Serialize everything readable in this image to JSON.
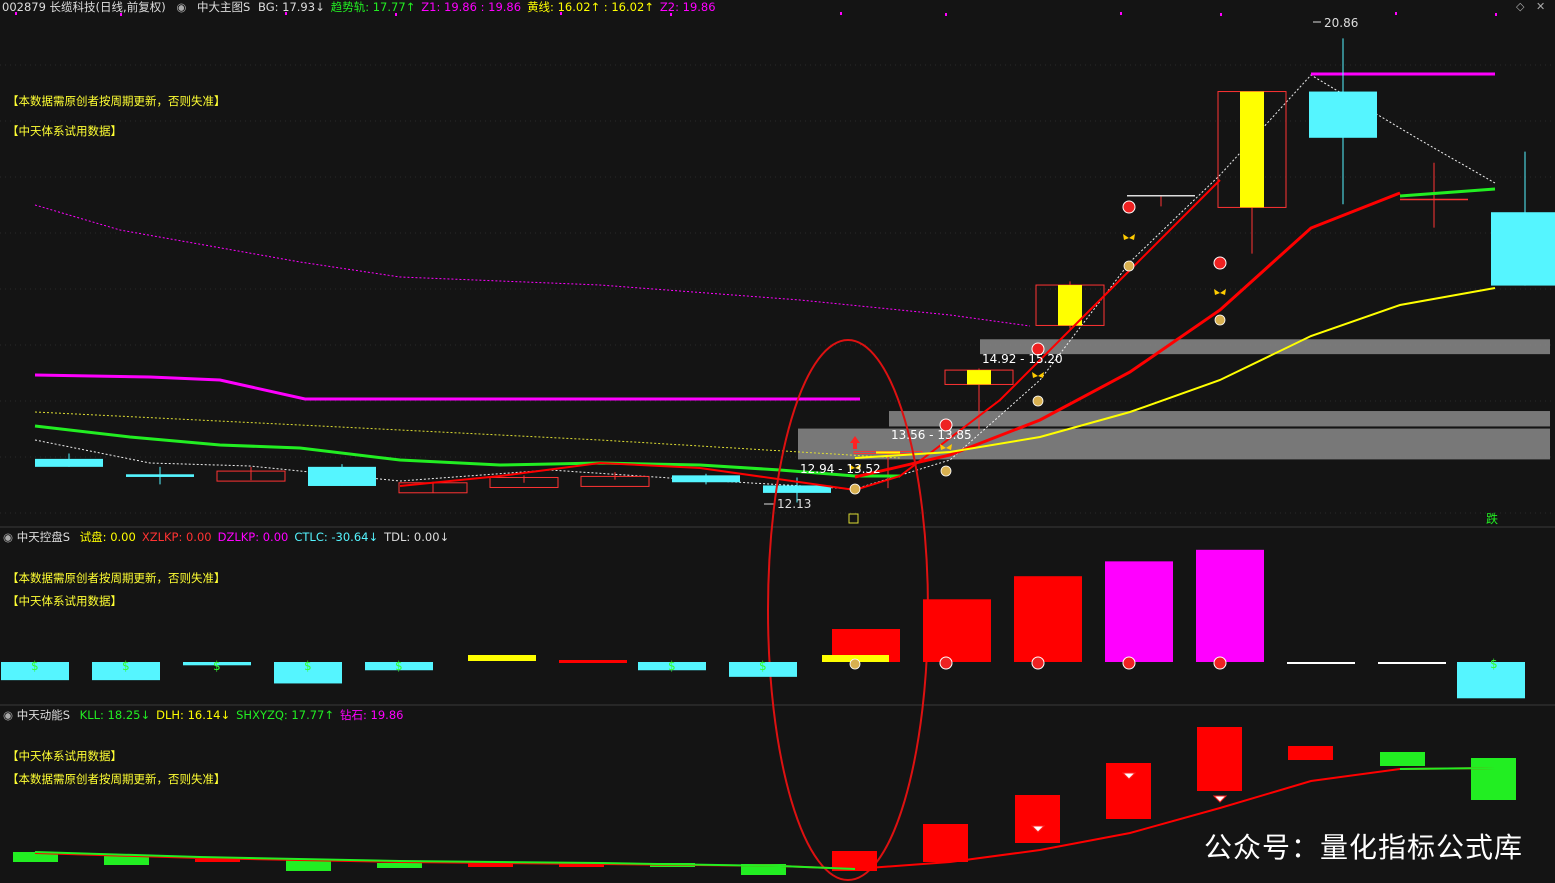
{
  "colors": {
    "background": "#141414",
    "cyan": "#55f5ff",
    "red": "#ff0000",
    "yellow": "#ffff00",
    "magenta": "#ff00ff",
    "green": "#22ee22",
    "gray": "#8a8a8a",
    "white": "#ffffff"
  },
  "main_panel": {
    "stock_label": "002879 长缆科技(日线,前复权)",
    "indicator_name": "中大主图S",
    "params": [
      {
        "text": "BG: 17.93↓",
        "color": "#dddddd"
      },
      {
        "text": "趋势轨: 17.77↑",
        "color": "#22ee22"
      },
      {
        "text": "Z1: 19.86 : 19.86",
        "color": "#ff00ff"
      },
      {
        "text": "黄线: 16.02↑ : 16.02↑",
        "color": "#ffff00"
      },
      {
        "text": "Z2: 19.86",
        "color": "#ff00ff"
      }
    ],
    "notes": [
      "【本数据需原创者按周期更新，否则失准】",
      "【中天体系试用数据】"
    ],
    "price_labels": {
      "high": "20.86",
      "low": "12.13",
      "zone1": "14.92 - 15.20",
      "zone2": "13.56 - 13.85",
      "zone3": "12.94 - 13.52"
    },
    "fall_mark": "跌",
    "expand_icon": "diamond-icon",
    "close_icon": "close-icon"
  },
  "panel2": {
    "title": "中天控盘S",
    "params": [
      {
        "text": "试盘: 0.00",
        "color": "#ffff00"
      },
      {
        "text": "XZLKP: 0.00",
        "color": "#ff3333"
      },
      {
        "text": "DZLKP: 0.00",
        "color": "#ff00ff"
      },
      {
        "text": "CTLC: -30.64↓",
        "color": "#55f5ff"
      },
      {
        "text": "TDL: 0.00↓",
        "color": "#dddddd"
      }
    ],
    "notes": [
      "【本数据需原创者按周期更新，否则失准】",
      "【中天体系试用数据】"
    ]
  },
  "panel3": {
    "title": "中天动能S",
    "params": [
      {
        "text": "KLL: 18.25↓",
        "color": "#22ee22"
      },
      {
        "text": "DLH: 16.14↓",
        "color": "#ffff00"
      },
      {
        "text": "SHXYZQ: 17.77↑",
        "color": "#22ee22"
      },
      {
        "text": "钻石: 19.86",
        "color": "#ff00ff"
      }
    ],
    "notes": [
      "【中天体系试用数据】",
      "【本数据需原创者按周期更新，否则失准】"
    ]
  },
  "watermark": "公众号：量化指标公式库",
  "chart_data": {
    "type": "candlestick",
    "title": "002879 长缆科技(日线,前复权)",
    "candles": [
      {
        "o": 12.95,
        "h": 13.05,
        "l": 12.8,
        "c": 12.8,
        "type": "down"
      },
      {
        "o": 12.66,
        "h": 12.8,
        "l": 12.47,
        "c": 12.61,
        "type": "down"
      },
      {
        "o": 12.65,
        "h": 12.8,
        "l": 12.55,
        "c": 12.72,
        "type": "up-hollow"
      },
      {
        "o": 12.8,
        "h": 12.85,
        "l": 12.44,
        "c": 12.44,
        "type": "down"
      },
      {
        "o": 12.42,
        "h": 12.52,
        "l": 12.31,
        "c": 12.5,
        "type": "up-hollow"
      },
      {
        "o": 12.54,
        "h": 12.64,
        "l": 12.5,
        "c": 12.6,
        "type": "up-hollow"
      },
      {
        "o": 12.6,
        "h": 12.7,
        "l": 12.56,
        "c": 12.62,
        "type": "up-hollow"
      },
      {
        "o": 12.64,
        "h": 12.67,
        "l": 12.47,
        "c": 12.51,
        "type": "down"
      },
      {
        "o": 12.45,
        "h": 12.6,
        "l": 12.13,
        "c": 12.31,
        "type": "down"
      },
      {
        "o": 13.09,
        "h": 13.09,
        "l": 12.4,
        "c": 13.05,
        "type": "up-yellow"
      },
      {
        "o": 14.35,
        "h": 14.65,
        "l": 13.5,
        "c": 14.62,
        "type": "up-yellow"
      },
      {
        "o": 15.46,
        "h": 16.29,
        "l": 15.4,
        "c": 16.22,
        "type": "up-yellow"
      },
      {
        "o": 17.9,
        "h": 17.9,
        "l": 17.7,
        "c": 17.9,
        "type": "doji"
      },
      {
        "o": 17.68,
        "h": 19.86,
        "l": 16.81,
        "c": 19.86,
        "type": "up-yellow"
      },
      {
        "o": 18.99,
        "h": 20.86,
        "l": 17.74,
        "c": 19.86,
        "type": "up-cyan"
      },
      {
        "o": 17.82,
        "h": 18.52,
        "l": 17.3,
        "c": 17.83,
        "type": "doji"
      },
      {
        "o": 17.59,
        "h": 18.73,
        "l": 16.21,
        "c": 16.21,
        "type": "down"
      }
    ],
    "trend_line_green": [
      13.0,
      12.88,
      12.76,
      12.69,
      12.56,
      12.54,
      12.53,
      12.51,
      12.44,
      12.35
    ],
    "trend_line_red": [
      12.37,
      12.48,
      12.56,
      12.62,
      12.56,
      12.58,
      13.06,
      13.49,
      14.25,
      15.3,
      16.6,
      17.6,
      17.76,
      17.77
    ],
    "yellow_line": [
      12.6,
      12.63,
      13.0,
      13.35,
      14.0,
      14.8,
      15.6,
      16.02
    ],
    "magenta_line": [
      14.43,
      14.41,
      14.38,
      14.03,
      14.02,
      14.02,
      14.02,
      14.02,
      14.02,
      19.86,
      19.86,
      19.86
    ],
    "ylim": [
      11.8,
      21.3
    ],
    "zones": [
      {
        "label": "14.92 - 15.20",
        "low": 14.92,
        "high": 15.2
      },
      {
        "label": "13.56 - 13.85",
        "low": 13.56,
        "high": 13.85
      },
      {
        "label": "12.94 - 13.52",
        "low": 12.94,
        "high": 13.52
      }
    ],
    "control_bars": [
      -0.55,
      -0.55,
      -0.1,
      -0.65,
      -0.25,
      0.2,
      0.05,
      -0.25,
      -0.45,
      1.0,
      1.9,
      2.6,
      3.05,
      3.4,
      0.0,
      0.0,
      -1.1
    ],
    "momentum_bars": [
      -0.2,
      -0.2,
      -0.05,
      -0.25,
      -0.05,
      -0.05,
      -0.05,
      -0.05,
      -0.1,
      0.3,
      0.8,
      1.5,
      2.2,
      2.85,
      3.15,
      3.25,
      3.4
    ]
  }
}
